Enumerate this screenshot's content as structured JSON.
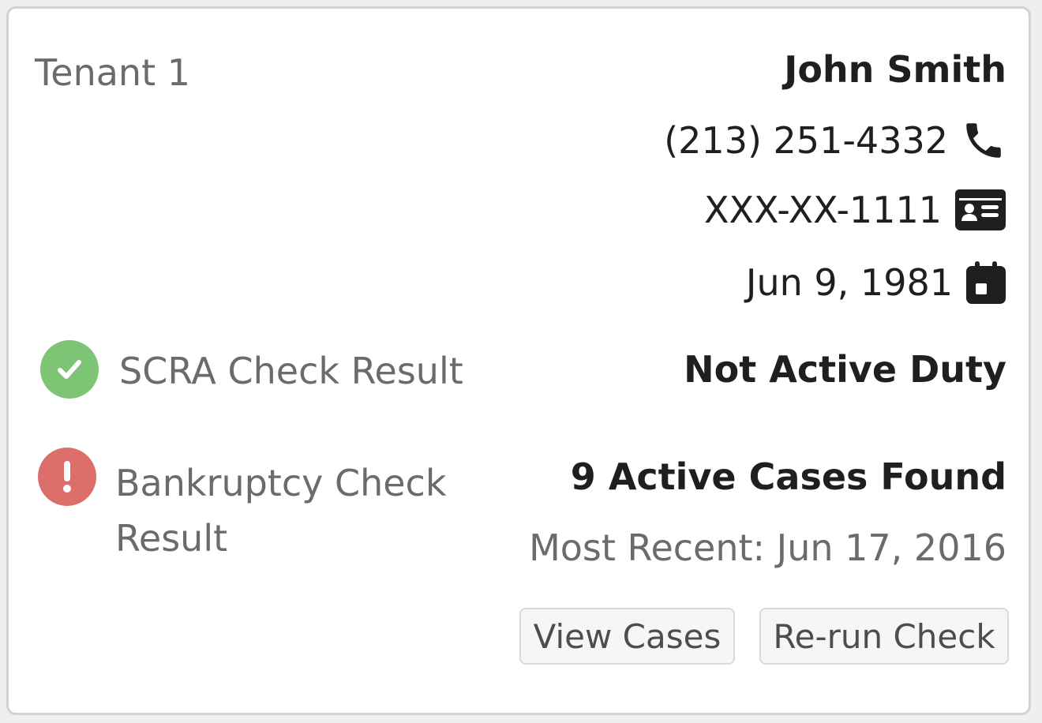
{
  "tenant": {
    "label": "Tenant 1",
    "name": "John Smith",
    "phone": "(213) 251-4332",
    "ssn": "XXX-XX-1111",
    "dob": "Jun 9, 1981"
  },
  "icons": {
    "phone": "phone-icon",
    "id_card": "id-card-icon",
    "calendar": "calendar-icon",
    "success": "check-circle-icon",
    "alert": "exclamation-circle-icon"
  },
  "colors": {
    "success": "#7dc474",
    "danger": "#dc6f6b"
  },
  "scra": {
    "label": "SCRA Check Result",
    "result": "Not Active Duty"
  },
  "bankruptcy": {
    "label_line1": "Bankruptcy Check",
    "label_line2": "Result",
    "result": "9 Active Cases Found",
    "most_recent": "Most Recent: Jun 17, 2016"
  },
  "buttons": {
    "view_cases": "View Cases",
    "rerun": "Re-run Check"
  }
}
